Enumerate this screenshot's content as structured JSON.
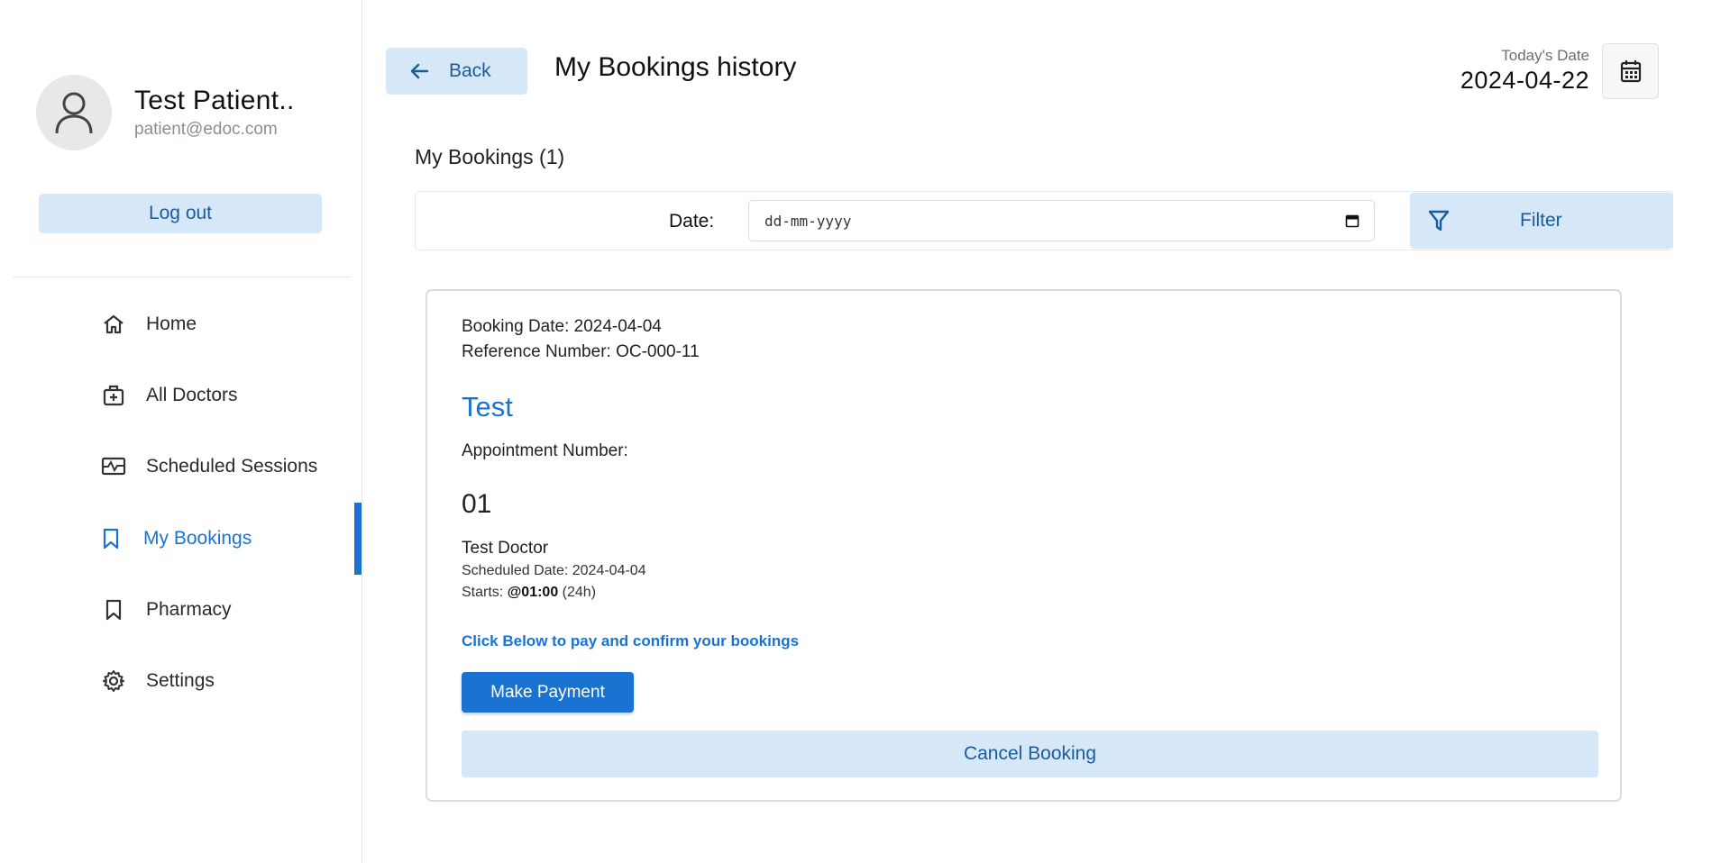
{
  "profile": {
    "name": "Test Patient..",
    "email": "patient@edoc.com"
  },
  "sidebar": {
    "logout_label": "Log out",
    "items": [
      {
        "label": "Home",
        "icon": "home-icon"
      },
      {
        "label": "All Doctors",
        "icon": "medical-bag-icon"
      },
      {
        "label": "Scheduled Sessions",
        "icon": "monitor-pulse-icon"
      },
      {
        "label": "My Bookings",
        "icon": "bookmark-icon",
        "active": true
      },
      {
        "label": "Pharmacy",
        "icon": "bookmark-icon"
      },
      {
        "label": "Settings",
        "icon": "gear-icon"
      }
    ]
  },
  "header": {
    "back_label": "Back",
    "title": "My Bookings history",
    "today_label": "Today's Date",
    "today_value": "2024-04-22"
  },
  "filter": {
    "section_title": "My Bookings (1)",
    "date_label": "Date:",
    "date_placeholder": "dd-mm-yyyy",
    "filter_label": "Filter"
  },
  "booking": {
    "booking_date": "Booking Date: 2024-04-04",
    "reference": "Reference Number: OC-000-11",
    "session_title": "Test",
    "appointment_label": "Appointment Number:",
    "appointment_number": "01",
    "doctor": "Test Doctor",
    "scheduled_date": "Scheduled Date: 2024-04-04",
    "starts_prefix": "Starts: ",
    "starts_time": "@01:00",
    "starts_suffix": " (24h)",
    "pay_hint": "Click Below to pay and confirm your bookings",
    "pay_label": "Make Payment",
    "cancel_label": "Cancel Booking"
  },
  "colors": {
    "accent": "#1a73d1",
    "light_accent": "#d6e8f8",
    "dark_accent": "#1a5c9a"
  }
}
